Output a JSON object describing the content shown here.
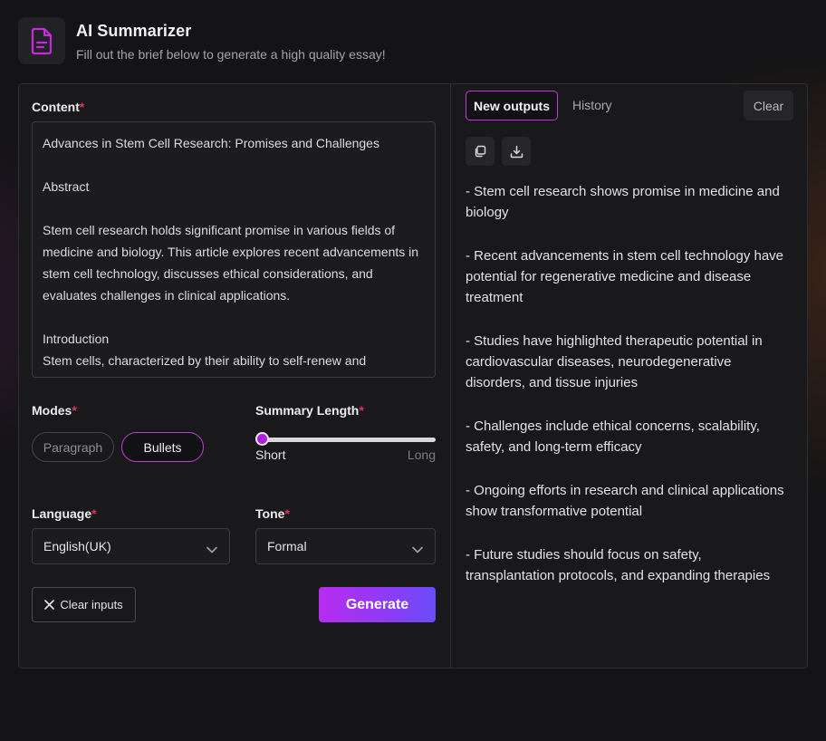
{
  "header": {
    "title": "AI Summarizer",
    "subtitle": "Fill out the brief below to generate a high quality essay!",
    "icon": "document-icon",
    "accent": "#c52bd8"
  },
  "form": {
    "content_label": "Content",
    "required_mark": "*",
    "content_text": "Advances in Stem Cell Research: Promises and Challenges\n\nAbstract\n\nStem cell research holds significant promise in various fields of medicine and biology. This article explores recent advancements in stem cell technology, discusses ethical considerations, and evaluates challenges in clinical applications.\n\nIntroduction\nStem cells, characterized by their ability to self-renew and",
    "modes_label": "Modes",
    "modes": [
      "Paragraph",
      "Bullets"
    ],
    "selected_mode": "Bullets",
    "summary_length_label": "Summary Length",
    "slider_min_label": "Short",
    "slider_max_label": "Long",
    "slider_value_fraction": 0,
    "language_label": "Language",
    "language_value": "English(UK)",
    "tone_label": "Tone",
    "tone_value": "Formal",
    "clear_inputs_label": "Clear inputs",
    "generate_label": "Generate"
  },
  "output": {
    "tab_new": "New outputs",
    "tab_history": "History",
    "clear_label": "Clear",
    "copy_icon": "copy-icon",
    "download_icon": "download-icon",
    "bullets": [
      "- Stem cell research shows promise in medicine and biology",
      "- Recent advancements in stem cell technology have potential for regenerative medicine and disease treatment",
      "- Studies have highlighted therapeutic potential in cardiovascular diseases, neurodegenerative disorders, and tissue injuries",
      "- Challenges include ethical concerns, scalability, safety, and long-term efficacy",
      "- Ongoing efforts in research and clinical applications show transformative potential",
      "- Future studies should focus on safety, transplantation protocols, and expanding therapies"
    ]
  }
}
